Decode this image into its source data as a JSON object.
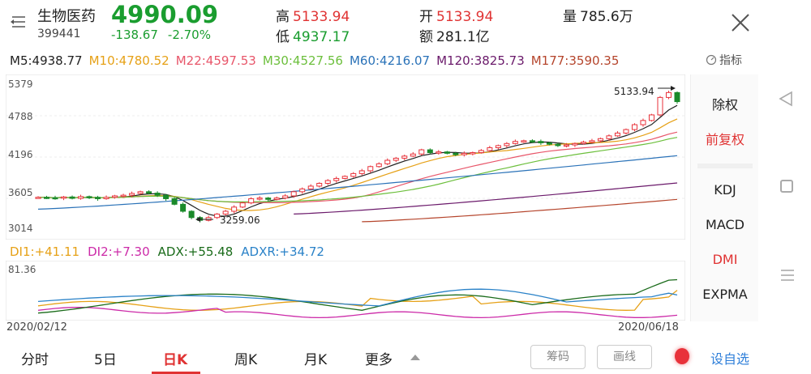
{
  "header": {
    "name": "生物医药",
    "code": "399441",
    "price": "4990.09",
    "change": "-138.67",
    "change_pct": "-2.70%",
    "high_label": "高",
    "high": "5133.94",
    "low_label": "低",
    "low": "4937.17",
    "open_label": "开",
    "open": "5133.94",
    "amount_label": "额",
    "amount": "281.1亿",
    "volume_label": "量",
    "volume": "785.6万"
  },
  "ma": [
    {
      "label": "M5:4938.77",
      "color": "#222222"
    },
    {
      "label": "M10:4780.52",
      "color": "#e6a117"
    },
    {
      "label": "M22:4597.53",
      "color": "#e8566a"
    },
    {
      "label": "M30:4527.56",
      "color": "#6cbf3c"
    },
    {
      "label": "M60:4216.07",
      "color": "#2a72b8"
    },
    {
      "label": "M120:3825.73",
      "color": "#6b1a6b"
    },
    {
      "label": "M177:3590.35",
      "color": "#b5452c"
    }
  ],
  "indicator_button": "指标",
  "axis": {
    "y_top": "5379",
    "y_2": "4788",
    "y_3": "4196",
    "y_4": "3605",
    "y_bottom": "3014",
    "annot_high": "5133.94",
    "annot_low": "3259.06"
  },
  "dmi": {
    "di1": {
      "label": "DI1:+41.11",
      "color": "#e6a117"
    },
    "di2": {
      "label": "DI2:+7.30",
      "color": "#cc2aa8"
    },
    "adx": {
      "label": "ADX:+55.48",
      "color": "#1a6b1a"
    },
    "adxr": {
      "label": "ADXR:+34.72",
      "color": "#2a82c8"
    },
    "top_value": "81.36"
  },
  "dates": {
    "start": "2020/02/12",
    "end": "2020/06/18"
  },
  "right_panel": {
    "chuquan": "除权",
    "qianfuquan": "前复权",
    "kdj": "KDJ",
    "macd": "MACD",
    "dmi": "DMI",
    "expma": "EXPMA"
  },
  "tabs": {
    "fenshi": "分时",
    "wuri": "5日",
    "rik": "日K",
    "zhouk": "周K",
    "yuek": "月K",
    "more": "更多"
  },
  "buttons": {
    "chouma": "筹码",
    "huaxian": "画线",
    "fav": "设自选"
  },
  "chart_data": [
    {
      "type": "candlestick",
      "title": "",
      "x_range": [
        "2020/02/12",
        "2020/06/18"
      ],
      "ylim": [
        3014,
        5379
      ],
      "y_ticks": [
        5379,
        4788,
        4196,
        3605,
        3014
      ],
      "annotations": [
        {
          "label": "5133.94",
          "kind": "period-high"
        },
        {
          "label": "3259.06",
          "kind": "period-low"
        }
      ],
      "close_series": [
        3620,
        3615,
        3610,
        3625,
        3605,
        3630,
        3620,
        3600,
        3620,
        3640,
        3650,
        3675,
        3700,
        3680,
        3650,
        3600,
        3520,
        3420,
        3330,
        3290,
        3330,
        3380,
        3420,
        3480,
        3540,
        3600,
        3610,
        3590,
        3610,
        3640,
        3700,
        3740,
        3780,
        3820,
        3860,
        3890,
        3920,
        3960,
        4000,
        4060,
        4100,
        4150,
        4180,
        4210,
        4240,
        4300,
        4260,
        4270,
        4250,
        4230,
        4250,
        4260,
        4290,
        4330,
        4360,
        4390,
        4420,
        4430,
        4420,
        4400,
        4380,
        4360,
        4370,
        4390,
        4410,
        4430,
        4460,
        4500,
        4540,
        4590,
        4660,
        4720,
        4800,
        5050,
        5120,
        4990
      ]
    },
    {
      "type": "line",
      "title": "",
      "series": [
        {
          "name": "DI1",
          "last": 41.11
        },
        {
          "name": "DI2",
          "last": 7.3
        },
        {
          "name": "ADX",
          "last": 55.48
        },
        {
          "name": "ADXR",
          "last": 34.72
        }
      ],
      "ylim": [
        0,
        81.36
      ]
    }
  ]
}
